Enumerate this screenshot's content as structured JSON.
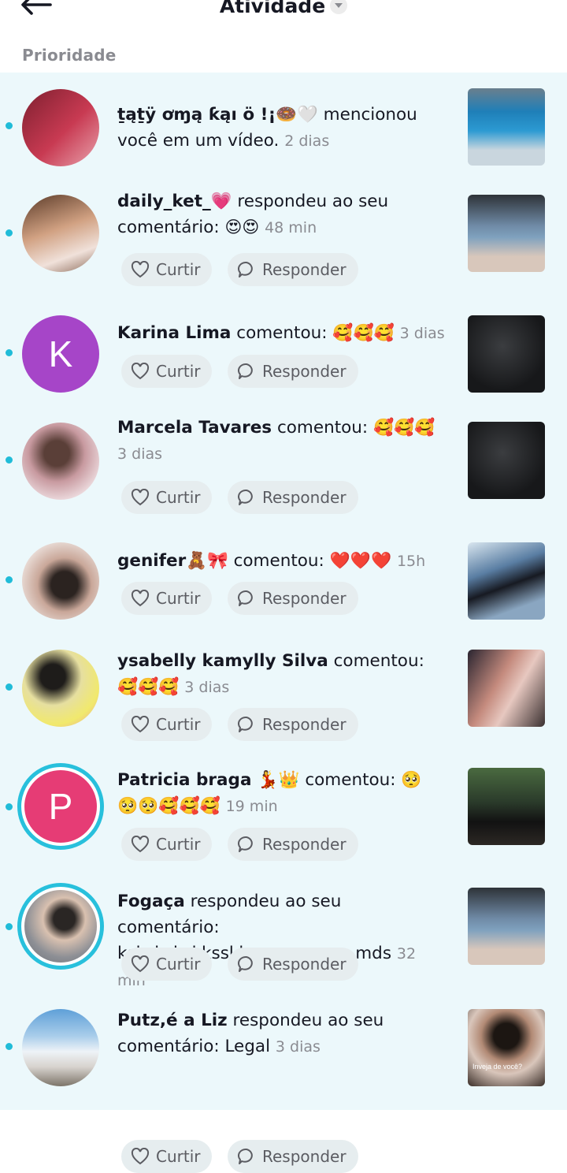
{
  "header": {
    "title": "Atividade",
    "section": "Prioridade"
  },
  "actions": {
    "like": "Curtir",
    "reply": "Responder"
  },
  "items": [
    {
      "name": "ṯąṯÿ ơɱą ƙąı ö !¡🍩🤍",
      "action": "mencionou você em um vídeo.",
      "emoji": "",
      "time": "2 dias",
      "avatar_letter": "",
      "avatar_color": "#b2243f",
      "has_actions": false
    },
    {
      "name": "daily_ket_💗",
      "action": "respondeu ao seu comentário:",
      "emoji": "😍😍",
      "time": "48 min",
      "avatar_letter": "",
      "avatar_color": "#d8b6a0",
      "has_actions": true
    },
    {
      "name": "Karina Lima",
      "action": "comentou:",
      "emoji": "🥰🥰🥰",
      "time": "3 dias",
      "avatar_letter": "K",
      "avatar_color": "#a645c8",
      "has_actions": true
    },
    {
      "name": "Marcela Tavares",
      "action": "comentou:",
      "emoji": "🥰🥰🥰",
      "time": "3 dias",
      "avatar_letter": "",
      "avatar_color": "#d6b9b9",
      "has_actions": true
    },
    {
      "name": "genifer🧸🎀",
      "action": "comentou:",
      "emoji": "❤️❤️❤️",
      "time": "15h",
      "avatar_letter": "",
      "avatar_color": "#d9c3b3",
      "has_actions": true
    },
    {
      "name": "ysabelly kamylly Silva",
      "action": "comentou:",
      "emoji": "🥰🥰🥰",
      "time": "3 dias",
      "avatar_letter": "",
      "avatar_color": "#e5e08a",
      "has_actions": true
    },
    {
      "name": "Patricia braga 💃👑",
      "action": "comentou:",
      "emoji": "🥺🥺🥺🥰🥰🥰",
      "time": "19 min",
      "avatar_letter": "P",
      "avatar_color": "#e63c75",
      "has_actions": true
    },
    {
      "name": "Fogaça",
      "action": "respondeu ao seu comentário:",
      "emoji": "kskskskskksskksmsmsmsm mds",
      "time": "32 min",
      "avatar_letter": "",
      "avatar_color": "#8d8f95",
      "has_actions": true
    },
    {
      "name": "Putz,é a Liz",
      "action": "respondeu ao seu comentário:",
      "emoji": "Legal",
      "time": "3 dias",
      "avatar_letter": "",
      "avatar_color": "#6fa6cf",
      "has_actions": true
    }
  ],
  "thumb_texts": {
    "last": "Inveja de você?"
  }
}
